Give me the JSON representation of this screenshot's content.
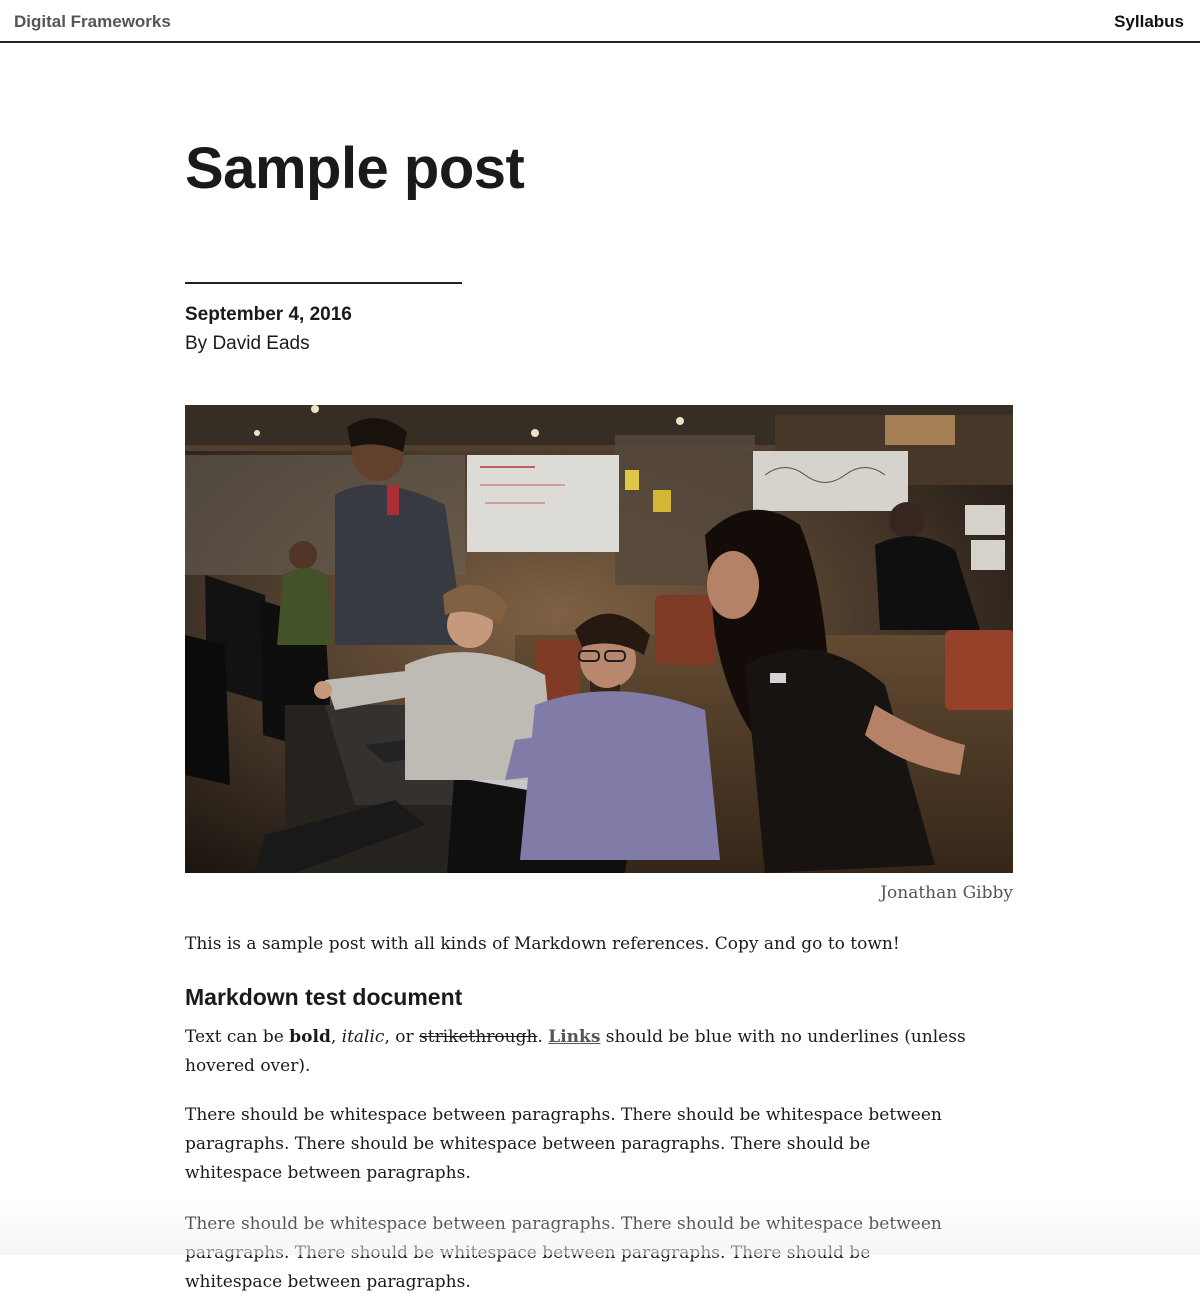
{
  "header": {
    "site_title": "Digital Frameworks",
    "nav_label": "Syllabus"
  },
  "post": {
    "title": "Sample post",
    "date": "September 4, 2016",
    "author": "By David Eads",
    "image_caption": "Jonathan Gibby",
    "intro": "This is a sample post with all kinds of Markdown references. Copy and go to town!",
    "section_heading": "Markdown test document",
    "formatting_paragraph": {
      "before_bold": "Text can be ",
      "bold": "bold",
      "sep1": ", ",
      "italic": "italic",
      "sep2": ", or ",
      "strike": "strikethrough",
      "sep3": ". ",
      "link": "Links",
      "after_link": " should be blue with no underlines (unless hovered over)."
    },
    "whitespace_paragraph_1": "There should be whitespace between paragraphs. There should be whitespace between paragraphs. There should be whitespace between paragraphs. There should be whitespace between paragraphs.",
    "whitespace_paragraph_2": "There should be whitespace between paragraphs. There should be whitespace between paragraphs. There should be whitespace between paragraphs. There should be whitespace between paragraphs."
  }
}
